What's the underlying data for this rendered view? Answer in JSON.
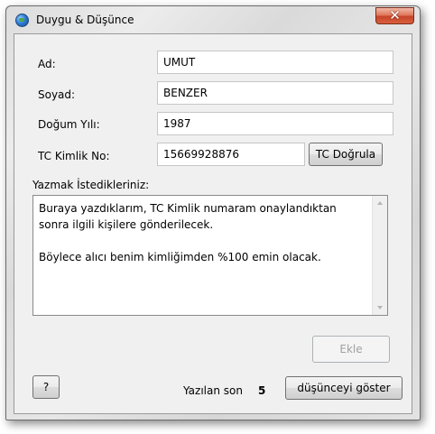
{
  "window": {
    "title": "Duygu & Düşünce",
    "close_symbol": "✕"
  },
  "form": {
    "ad": {
      "label": "Ad:",
      "value": "UMUT"
    },
    "soyad": {
      "label": "Soyad:",
      "value": "BENZER"
    },
    "dogum_yili": {
      "label": "Doğum Yılı:",
      "value": "1987"
    },
    "tc": {
      "label": "TC Kimlik No:",
      "value": "15669928876",
      "verify_button": "TC Doğrula"
    }
  },
  "message": {
    "label": "Yazmak İstedikleriniz:",
    "text": "Buraya yazdıklarım, TC Kimlik numaram onaylandıktan\nsonra ilgili kişilere gönderilecek.\n\nBöylece alıcı benim kimliğimden %100 emin olacak."
  },
  "actions": {
    "add_button": "Ekle",
    "help_button": "?",
    "status_label": "Yazılan son",
    "status_count": "5",
    "show_button": "düşünceyi göster"
  }
}
